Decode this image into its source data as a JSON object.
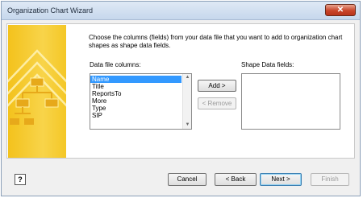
{
  "window": {
    "title": "Organization Chart Wizard",
    "close_glyph": "✕"
  },
  "instructions": "Choose the columns (fields) from your data file that you want to add to organization chart shapes as shape data fields.",
  "data_file_columns": {
    "label": "Data file columns:",
    "items": [
      "Name",
      "Title",
      "ReportsTo",
      "More",
      "Type",
      "SIP"
    ],
    "selected": "Name"
  },
  "shape_data_fields": {
    "label": "Shape Data fields:",
    "items": []
  },
  "buttons": {
    "add": "Add >",
    "remove": "< Remove",
    "cancel": "Cancel",
    "back": "< Back",
    "next": "Next >",
    "finish": "Finish",
    "help": "?"
  }
}
